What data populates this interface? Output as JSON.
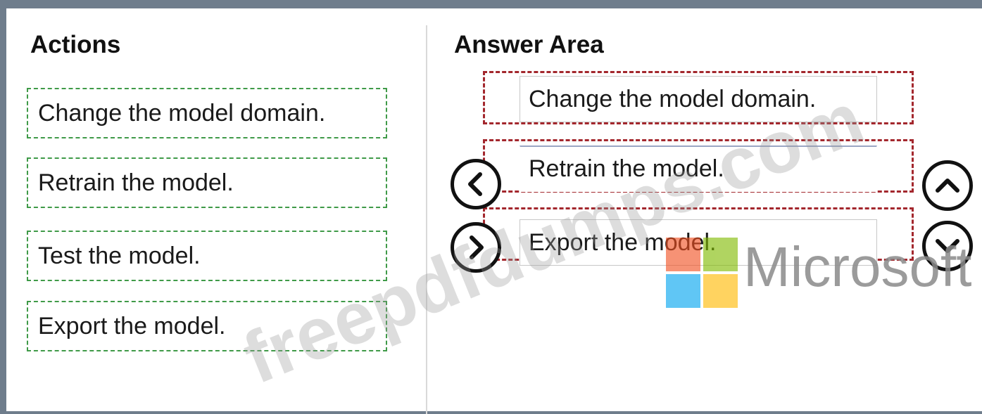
{
  "actions": {
    "title": "Actions",
    "items": [
      {
        "label": "Change the model domain."
      },
      {
        "label": "Retrain the model."
      },
      {
        "label": "Test the model."
      },
      {
        "label": "Export the model."
      }
    ]
  },
  "answer_area": {
    "title": "Answer Area",
    "items": [
      {
        "label": "Change the model domain."
      },
      {
        "label": "Retrain the model."
      },
      {
        "label": "Export the model."
      }
    ]
  },
  "controls": {
    "move_left_icon": "chevron-left-icon",
    "move_right_icon": "chevron-right-icon",
    "move_up_icon": "chevron-up-icon",
    "move_down_icon": "chevron-down-icon"
  },
  "overlay": {
    "watermark_text": "freepdfdumps.com",
    "logo_text": "Microsoft"
  },
  "colors": {
    "frame": "#6f7d8c",
    "action_border": "#3f9a48",
    "answer_border": "#a3272d",
    "ms_red": "#f25022",
    "ms_green": "#7fba00",
    "ms_blue": "#00a4ef",
    "ms_yellow": "#ffb900"
  }
}
